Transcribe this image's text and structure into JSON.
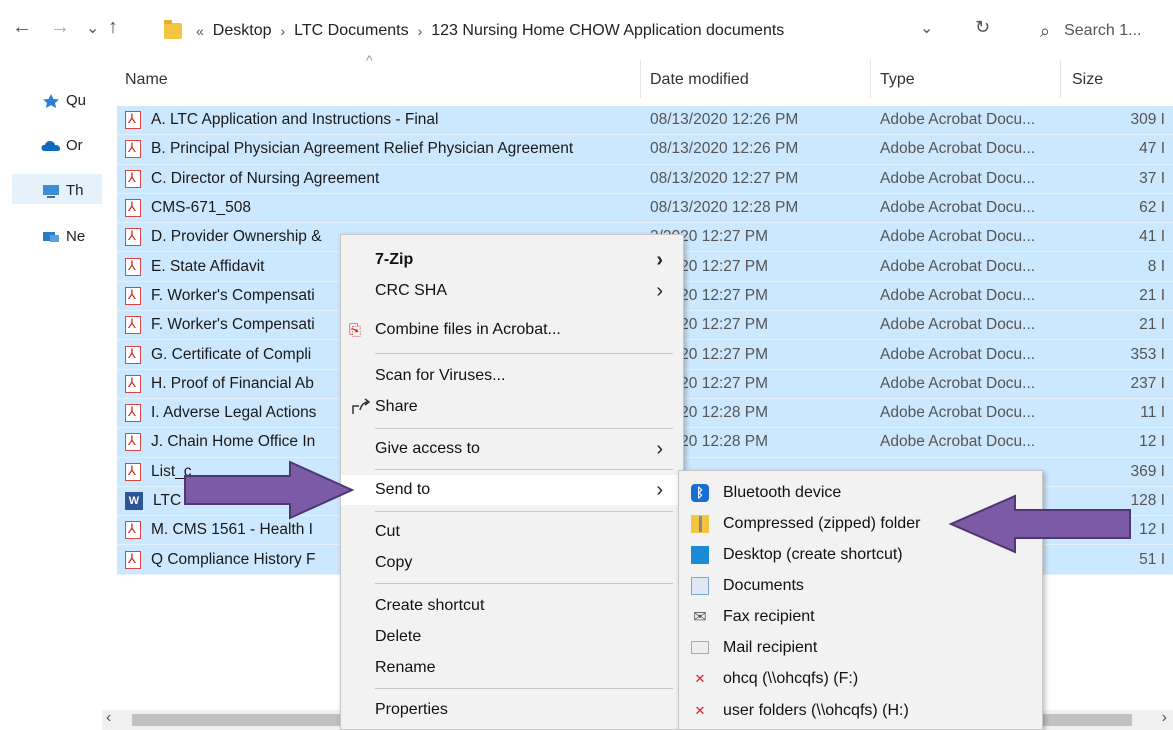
{
  "nav": {
    "back": "←",
    "forward": "→",
    "recent": "⌄",
    "up": "↑"
  },
  "address": {
    "overflow": "«",
    "crumbs": [
      "Desktop",
      "LTC Documents",
      "123 Nursing Home CHOW Application documents"
    ],
    "dropdown": "⌄",
    "refresh": "↻"
  },
  "search": {
    "icon": "⌕",
    "placeholder": "Search 1..."
  },
  "leftnav": {
    "items": [
      {
        "label": "Qu",
        "icon": "star-icon",
        "color": "#2f7fd8"
      },
      {
        "label": "Or",
        "icon": "cloud-icon",
        "color": "#0f6cbd"
      },
      {
        "label": "Th",
        "icon": "computer-icon",
        "color": "#3a8fd6"
      },
      {
        "label": "Ne",
        "icon": "network-icon",
        "color": "#2d7bc4"
      }
    ]
  },
  "columns": {
    "name": "Name",
    "date": "Date modified",
    "type": "Type",
    "size": "Size",
    "sort_indicator": "^"
  },
  "files": [
    {
      "name": "A. LTC Application and Instructions - Final",
      "date": "08/13/2020 12:26 PM",
      "type": "Adobe Acrobat Docu...",
      "size": "309 I",
      "icon": "pdf"
    },
    {
      "name": "B. Principal Physician Agreement Relief Physician Agreement",
      "date": "08/13/2020 12:26 PM",
      "type": "Adobe Acrobat Docu...",
      "size": "47 I",
      "icon": "pdf"
    },
    {
      "name": "C. Director of Nursing Agreement",
      "date": "08/13/2020 12:27 PM",
      "type": "Adobe Acrobat Docu...",
      "size": "37 I",
      "icon": "pdf"
    },
    {
      "name": "CMS-671_508",
      "date": "08/13/2020 12:28 PM",
      "type": "Adobe Acrobat Docu...",
      "size": "62 I",
      "icon": "pdf"
    },
    {
      "name": "D. Provider Ownership &",
      "date": "3/2020 12:27 PM",
      "type": "Adobe Acrobat Docu...",
      "size": "41 I",
      "icon": "pdf"
    },
    {
      "name": "E. State Affidavit",
      "date": "3/2020 12:27 PM",
      "type": "Adobe Acrobat Docu...",
      "size": "8 I",
      "icon": "pdf"
    },
    {
      "name": "F. Worker's Compensati",
      "date": "3/2020 12:27 PM",
      "type": "Adobe Acrobat Docu...",
      "size": "21 I",
      "icon": "pdf"
    },
    {
      "name": "F. Worker's Compensati",
      "date": "3/2020 12:27 PM",
      "type": "Adobe Acrobat Docu...",
      "size": "21 I",
      "icon": "pdf"
    },
    {
      "name": "G. Certificate of Compli",
      "date": "3/2020 12:27 PM",
      "type": "Adobe Acrobat Docu...",
      "size": "353 I",
      "icon": "pdf"
    },
    {
      "name": "H. Proof of Financial Ab",
      "date": "3/2020 12:27 PM",
      "type": "Adobe Acrobat Docu...",
      "size": "237 I",
      "icon": "pdf"
    },
    {
      "name": "I. Adverse Legal Actions",
      "date": "3/2020 12:28 PM",
      "type": "Adobe Acrobat Docu...",
      "size": "11 I",
      "icon": "pdf"
    },
    {
      "name": "J. Chain Home Office In",
      "date": "3/2020 12:28 PM",
      "type": "Adobe Acrobat Docu...",
      "size": "12 I",
      "icon": "pdf"
    },
    {
      "name": "List_c",
      "date": "",
      "type": "..",
      "size": "369 I",
      "icon": "pdf"
    },
    {
      "name": "LTC CHOW Submission",
      "date": "",
      "type": "..",
      "size": "128 I",
      "icon": "word"
    },
    {
      "name": "M. CMS 1561 - Health I",
      "date": "",
      "type": "..",
      "size": "12 I",
      "icon": "pdf"
    },
    {
      "name": "Q Compliance History F",
      "date": "",
      "type": "..",
      "size": "51 I",
      "icon": "pdf"
    }
  ],
  "context_menu": {
    "items": [
      {
        "label": "7-Zip",
        "bold": true,
        "submenu": true
      },
      {
        "label": "CRC SHA",
        "submenu": true
      },
      {
        "label": "Combine files in Acrobat...",
        "icon": "acrobat-combine-icon"
      },
      {
        "label": "Scan for Viruses..."
      },
      {
        "label": "Share",
        "icon": "share-icon"
      },
      {
        "label": "Give access to",
        "submenu": true
      },
      {
        "label": "Send to",
        "submenu": true,
        "highlighted": true
      },
      {
        "label": "Cut"
      },
      {
        "label": "Copy"
      },
      {
        "label": "Create shortcut"
      },
      {
        "label": "Delete"
      },
      {
        "label": "Rename"
      },
      {
        "label": "Properties"
      }
    ],
    "chevron": "›"
  },
  "send_to": {
    "items": [
      {
        "label": "Bluetooth device",
        "icon": "bluetooth-icon"
      },
      {
        "label": "Compressed (zipped) folder",
        "icon": "zip-folder-icon"
      },
      {
        "label": "Desktop (create shortcut)",
        "icon": "desktop-icon"
      },
      {
        "label": "Documents",
        "icon": "documents-icon"
      },
      {
        "label": "Fax recipient",
        "icon": "fax-icon"
      },
      {
        "label": "Mail recipient",
        "icon": "mail-icon"
      },
      {
        "label": "ohcq (\\\\ohcqfs) (F:)",
        "icon": "network-drive-icon"
      },
      {
        "label": "user folders (\\\\ohcqfs) (H:)",
        "icon": "network-drive-icon"
      }
    ]
  },
  "annotation_color": "#7b5aa6",
  "scroll": {
    "left": "‹",
    "right": "›"
  }
}
